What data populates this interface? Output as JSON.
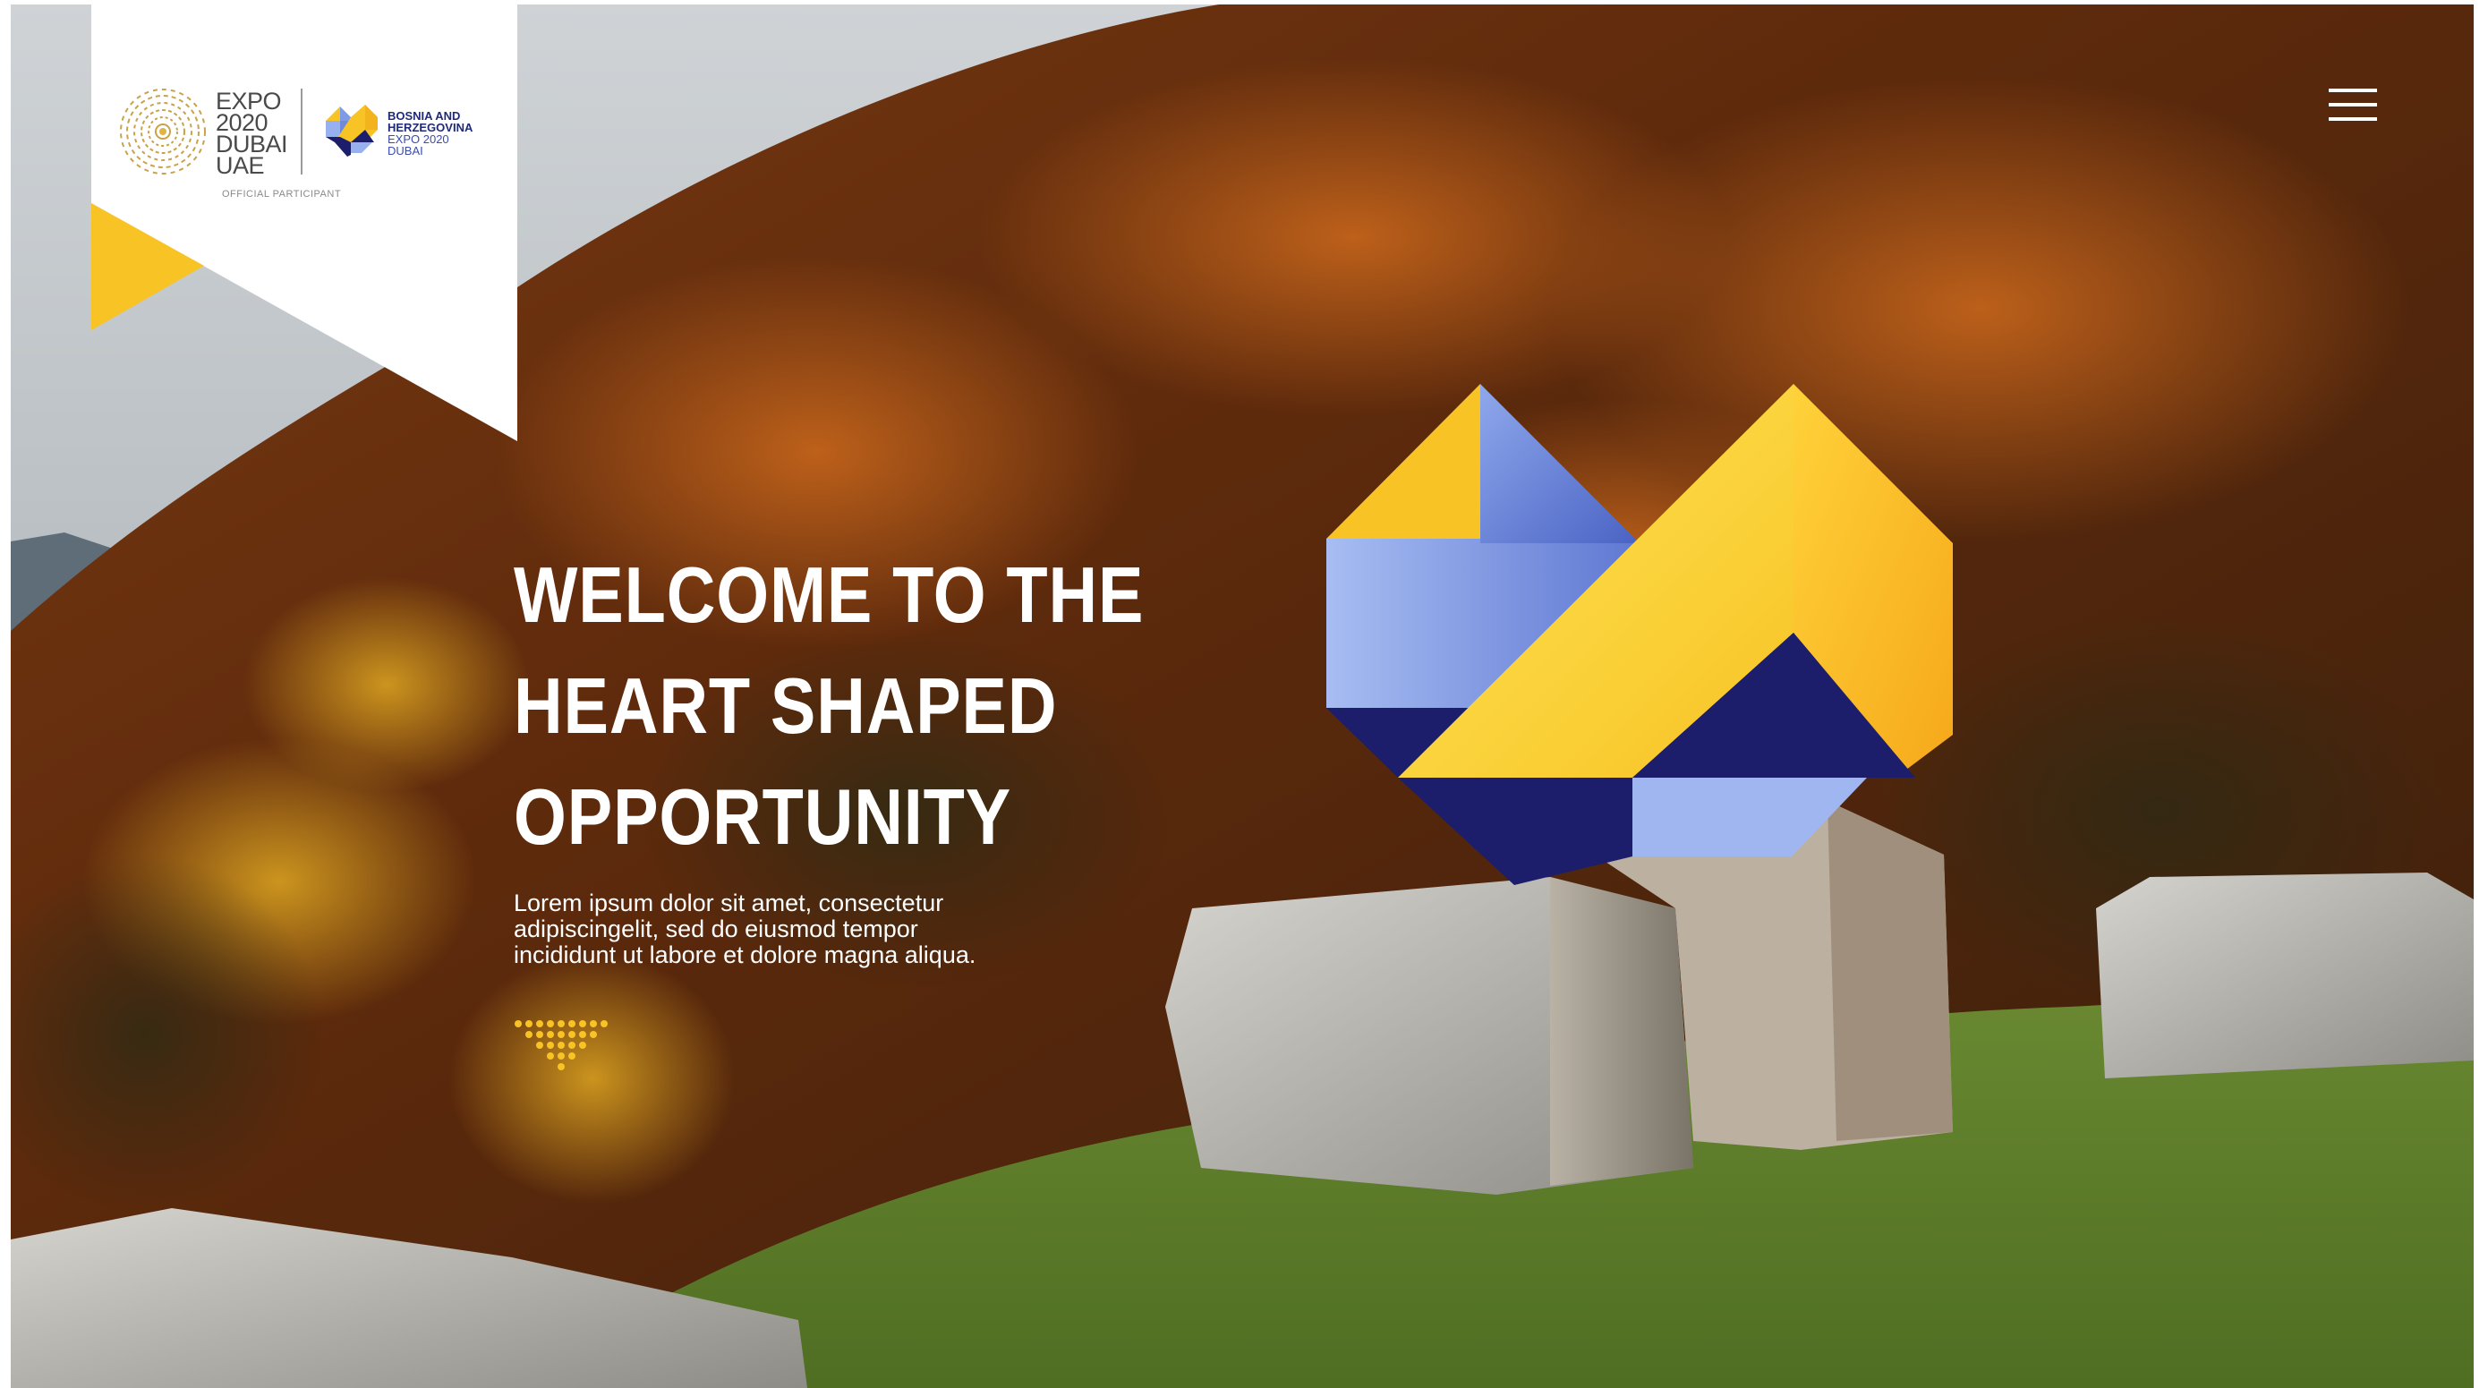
{
  "brand": {
    "expo_logo_text": "EXPO\n2020\nDUBAI\nUAE",
    "partner_name": "BOSNIA AND\nHERZEGOVINA",
    "partner_sub": "EXPO 2020\nDUBAI",
    "official_label": "OFFICIAL PARTICIPANT"
  },
  "hero": {
    "title_lines": [
      "WELCOME TO THE",
      "HEART SHAPED",
      "OPPORTUNITY"
    ],
    "body_lines": [
      "Lorem ipsum dolor sit amet, consectetur",
      "adipiscingelit, sed do eiusmod tempor",
      "incididunt ut labore et dolore magna aliqua."
    ]
  },
  "icons": {
    "menu": "hamburger-menu-icon",
    "scroll": "scroll-down-dots-icon"
  },
  "colors": {
    "yellow": "#F7C325",
    "navy": "#1C1E6B",
    "light_blue": "#7F9BE3",
    "white": "#FFFFFF"
  }
}
